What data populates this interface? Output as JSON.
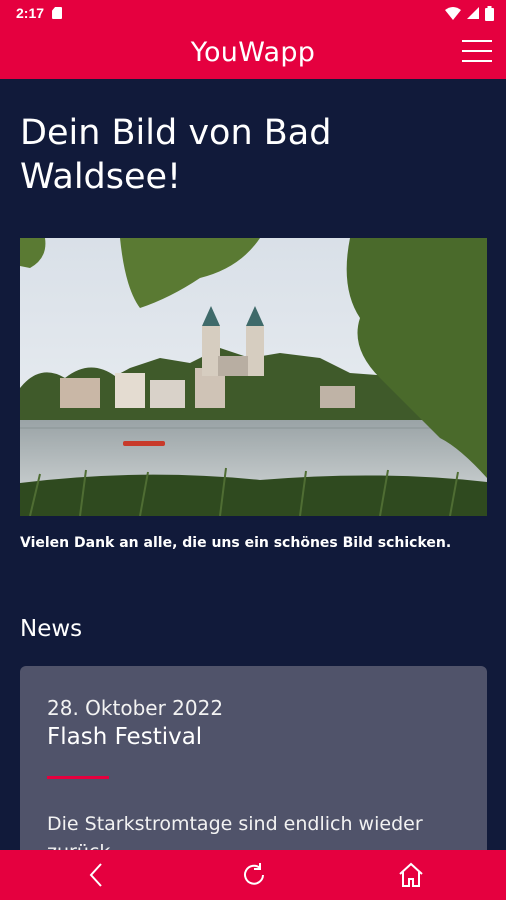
{
  "status_bar": {
    "time": "2:17"
  },
  "app_bar": {
    "title": "YouWapp"
  },
  "page": {
    "title": "Dein Bild von Bad Waldsee!",
    "caption": "Vielen Dank an alle, die uns ein schönes Bild schicken."
  },
  "news": {
    "section_title": "News",
    "items": [
      {
        "date": "28. Oktober 2022",
        "title": "Flash Festival",
        "excerpt": "Die Starkstromtage sind endlich wieder zurück"
      }
    ]
  },
  "colors": {
    "accent": "#e5003f",
    "background": "#111a3a",
    "card": "#50536a"
  },
  "icons": {
    "back": "chevron-left-icon",
    "reload": "reload-icon",
    "home": "home-icon",
    "menu": "hamburger-menu-icon"
  }
}
